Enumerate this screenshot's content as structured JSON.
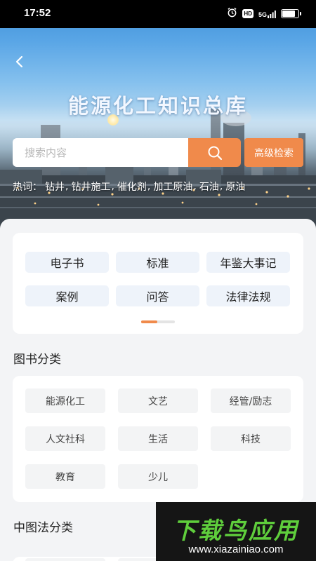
{
  "status_bar": {
    "time": "17:52",
    "hd_label": "HD",
    "network_label": "5G",
    "battery_level": 0.9
  },
  "header": {
    "title": "能源化工知识总库",
    "back_icon": "chevron-left-icon"
  },
  "search": {
    "placeholder": "搜索内容",
    "search_icon": "search-icon",
    "advanced_label": "高级检索",
    "accent_color": "#f08a4b"
  },
  "hot_words": {
    "label": "热词：",
    "items": [
      "钻井",
      "钻井施工",
      "催化剂",
      "加工原油",
      "石油",
      "原油"
    ]
  },
  "resource_types": {
    "items": [
      "电子书",
      "标准",
      "年鉴大事记",
      "案例",
      "问答",
      "法律法规"
    ],
    "page_indicator": {
      "current": 1,
      "total": 2
    }
  },
  "book_categories": {
    "title": "图书分类",
    "items": [
      "能源化工",
      "文艺",
      "经管/励志",
      "人文社科",
      "生活",
      "科技",
      "教育",
      "少儿"
    ]
  },
  "clc_categories": {
    "title": "中图法分类"
  },
  "watermark": {
    "logo_text": "下载鸟应用",
    "url": "www.xiazainiao.com"
  }
}
